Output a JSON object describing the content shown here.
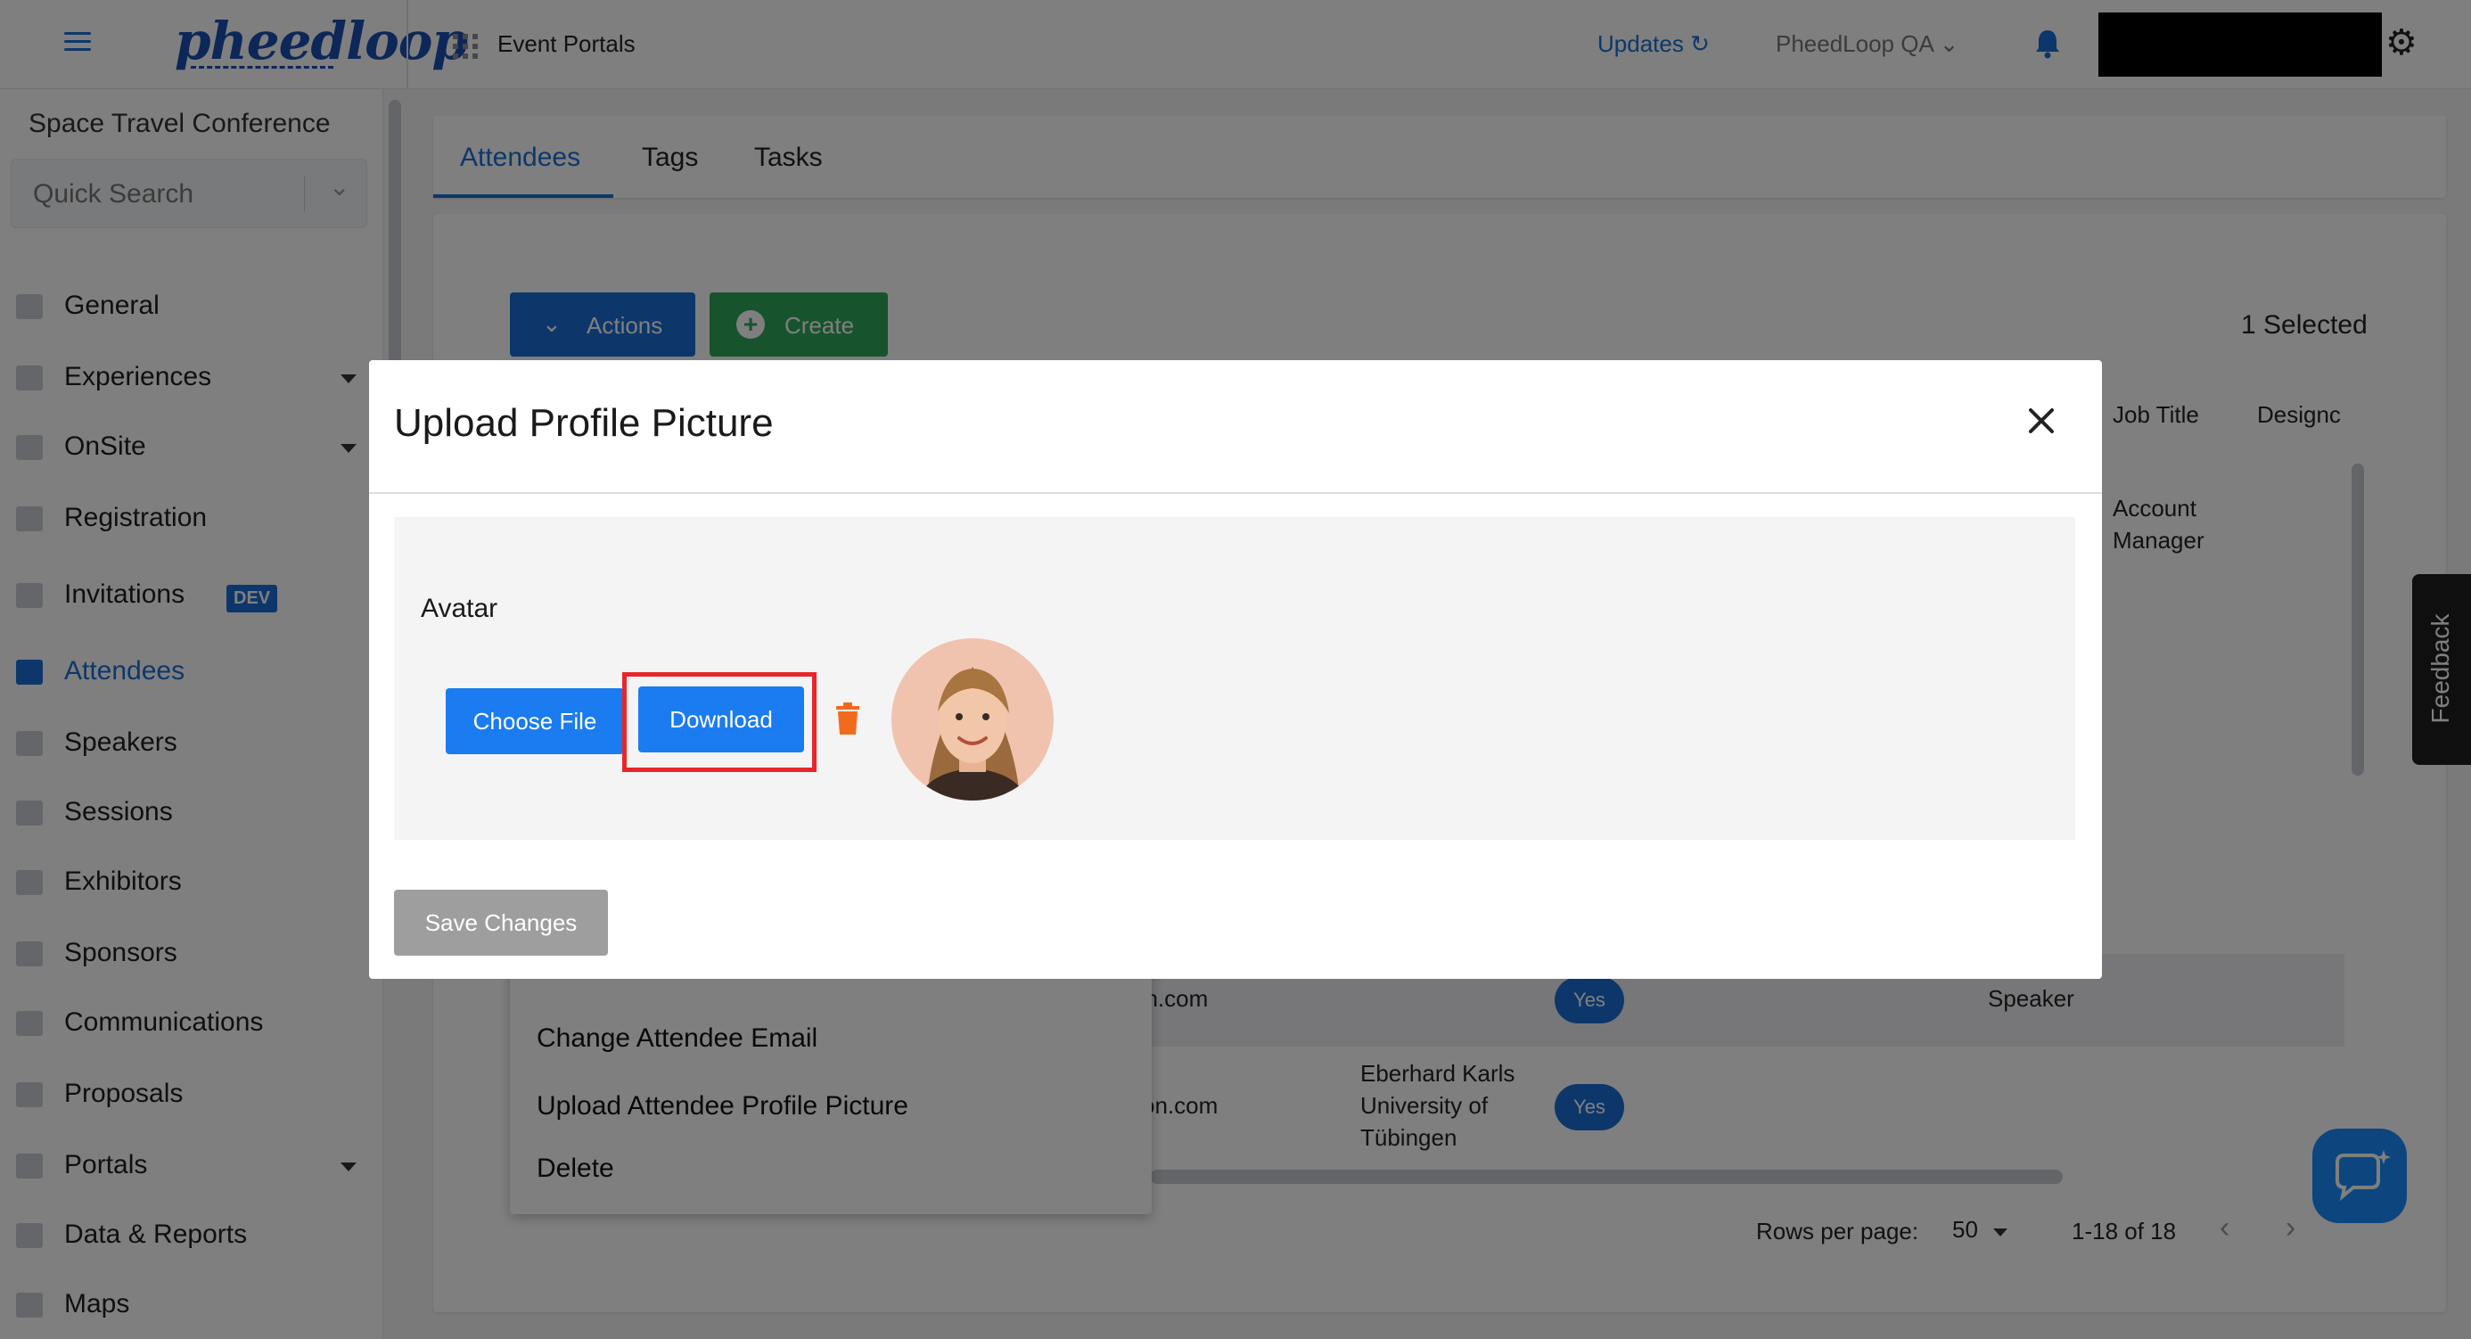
{
  "topbar": {
    "logo_text": "pheedloop",
    "app_section": "Event Portals",
    "updates_label": "Updates",
    "org_select": "PheedLoop QA"
  },
  "sidebar": {
    "event_name": "Space Travel Conference",
    "quick_search_placeholder": "Quick Search",
    "dev_badge": "DEV",
    "items": [
      {
        "label": "General",
        "icon": "grid-icon",
        "expandable": false
      },
      {
        "label": "Experiences",
        "icon": "person-icon",
        "expandable": true
      },
      {
        "label": "OnSite",
        "icon": "printer-icon",
        "expandable": true
      },
      {
        "label": "Registration",
        "icon": "cart-icon",
        "expandable": false
      },
      {
        "label": "Invitations",
        "icon": "envelope-icon",
        "expandable": false
      },
      {
        "label": "Attendees",
        "icon": "people-icon",
        "expandable": false,
        "active": true
      },
      {
        "label": "Speakers",
        "icon": "presentation-icon",
        "expandable": false
      },
      {
        "label": "Sessions",
        "icon": "laptop-icon",
        "expandable": false
      },
      {
        "label": "Exhibitors",
        "icon": "storefront-icon",
        "expandable": false
      },
      {
        "label": "Sponsors",
        "icon": "badge-icon",
        "expandable": false
      },
      {
        "label": "Communications",
        "icon": "envelope-icon",
        "expandable": false
      },
      {
        "label": "Proposals",
        "icon": "document-icon",
        "expandable": false
      },
      {
        "label": "Portals",
        "icon": "globe-icon",
        "expandable": true
      },
      {
        "label": "Data & Reports",
        "icon": "chart-icon",
        "expandable": false
      },
      {
        "label": "Maps",
        "icon": "map-icon",
        "expandable": false
      }
    ]
  },
  "main": {
    "tabs": [
      {
        "label": "Attendees",
        "active": true
      },
      {
        "label": "Tags",
        "active": false
      },
      {
        "label": "Tasks",
        "active": false
      }
    ],
    "actions_label": "Actions",
    "create_label": "Create",
    "selected_count": "1 Selected",
    "columns": {
      "job_title": "Job Title",
      "designation": "Designc"
    },
    "row1": {
      "job_title_line1": "Account",
      "job_title_line2": "Manager"
    },
    "row2": {
      "email_fragment": "on.com",
      "badge": "Yes",
      "designation": "Speaker"
    },
    "row3": {
      "email_fragment": "con.com",
      "org_line1": "Eberhard Karls",
      "org_line2": "University of",
      "org_line3": "Tübingen",
      "badge": "Yes"
    },
    "pagination": {
      "rows_label": "Rows per page:",
      "rows_value": "50",
      "range": "1-18 of 18"
    }
  },
  "context_menu": {
    "items": [
      "Change Attendee Email",
      "Upload Attendee Profile Picture",
      "Delete"
    ]
  },
  "feedback_label": "Feedback",
  "modal": {
    "title": "Upload Profile Picture",
    "field_label": "Avatar",
    "choose_file_label": "Choose File",
    "download_label": "Download",
    "save_label": "Save Changes"
  },
  "colors": {
    "accent": "#1b6fd6",
    "create_green": "#2fa85a",
    "highlight_red": "#e8262a",
    "trash_orange": "#f26b1d"
  }
}
